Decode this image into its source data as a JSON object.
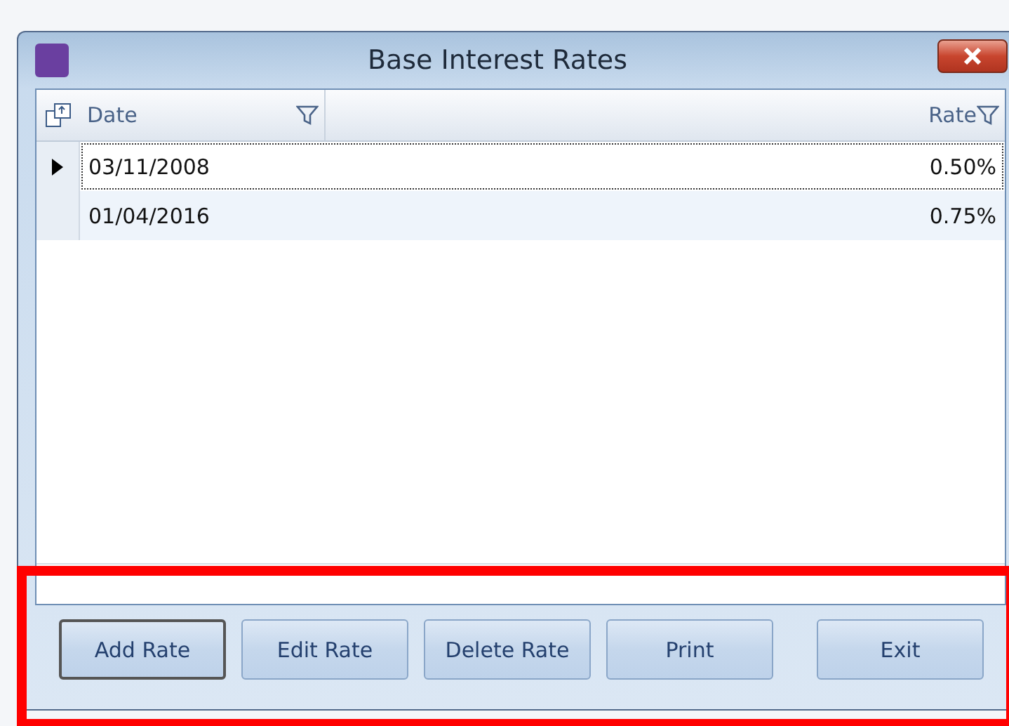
{
  "window": {
    "title": "Base Interest Rates"
  },
  "grid": {
    "columns": [
      {
        "label": "Date"
      },
      {
        "label": "Rate"
      }
    ],
    "rows": [
      {
        "cells": [
          "03/11/2008",
          "0.50%"
        ],
        "selected": true
      },
      {
        "cells": [
          "01/04/2016",
          "0.75%"
        ],
        "selected": false
      }
    ]
  },
  "buttons": [
    {
      "label": "Add Rate",
      "focused": true
    },
    {
      "label": "Edit Rate",
      "focused": false
    },
    {
      "label": "Delete Rate",
      "focused": false
    },
    {
      "label": "Print",
      "focused": false
    },
    {
      "label": "Exit",
      "focused": false
    }
  ],
  "highlight_buttons": true
}
